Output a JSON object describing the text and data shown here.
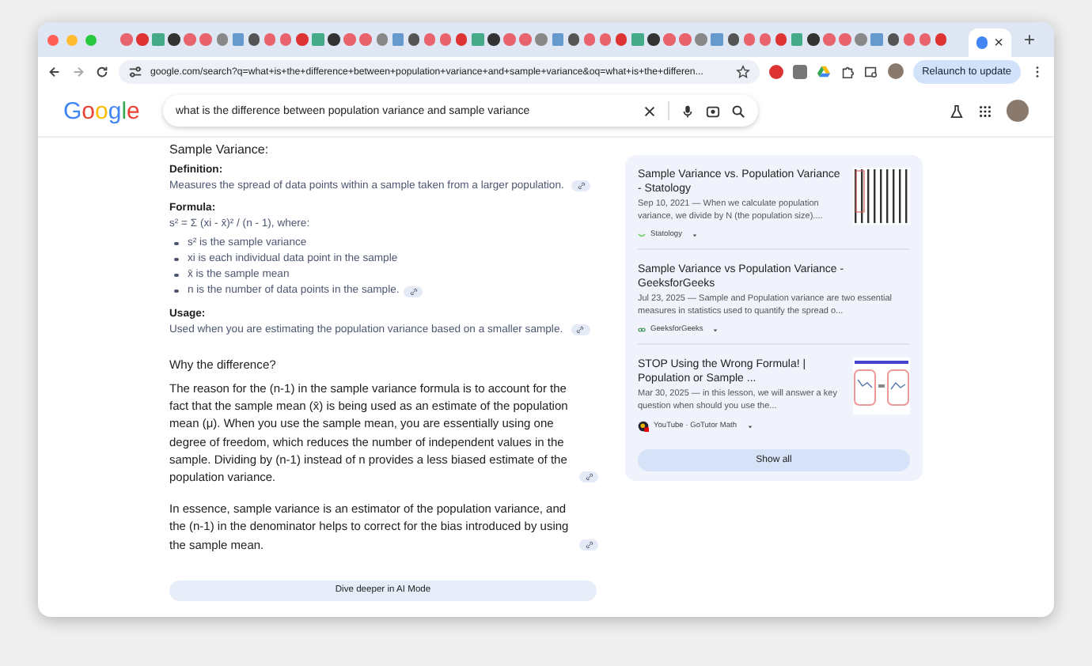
{
  "browser": {
    "new_tab": "+",
    "close_tab": "×",
    "url": "google.com/search?q=what+is+the+difference+between+population+variance+and+sample+variance&oq=what+is+the+differen...",
    "relaunch": "Relaunch to update"
  },
  "search": {
    "logo": "Google",
    "query": "what is the difference between population variance and sample variance"
  },
  "overview": {
    "heading": "Sample Variance:",
    "definition_label": "Definition:",
    "definition": "Measures the spread of data points within a sample taken from a larger population.",
    "formula_label": "Formula:",
    "formula": "s² = Σ (xi - x̄)² / (n - 1), where:",
    "bullets": [
      "s² is the sample variance",
      "xi is each individual data point in the sample",
      "x̄ is the sample mean",
      "n is the number of data points in the sample."
    ],
    "usage_label": "Usage:",
    "usage": "Used when you are estimating the population variance based on a smaller sample.",
    "why_heading": "Why the difference?",
    "paragraphs": [
      "The reason for the (n-1) in the sample variance formula is to account for the fact that the sample mean (x̄) is being used as an estimate of the population mean (μ). When you use the sample mean, you are essentially using one degree of freedom, which reduces the number of independent values in the sample. Dividing by (n-1) instead of n provides a less biased estimate of the population variance.",
      "In essence, sample variance is an estimator of the population variance, and the (n-1) in the denominator helps to correct for the bias introduced by using the sample mean."
    ],
    "dive_button": "Dive deeper in AI Mode"
  },
  "results": [
    {
      "title": "Sample Variance vs. Population Variance - Statology",
      "snippet": "Sep 10, 2021 — When we calculate population variance, we divide by N (the population size)....",
      "source": "Statology",
      "kind": "statology"
    },
    {
      "title": "Sample Variance vs Population Variance - GeeksforGeeks",
      "snippet": "Jul 23, 2025 — Sample and Population variance are two essential measures in statistics used to quantify the spread o...",
      "source": "GeeksforGeeks",
      "kind": "gfg"
    },
    {
      "title": "STOP Using the Wrong Formula! | Population or Sample ...",
      "snippet": "Mar 30, 2025 — in this lesson, we will answer a key question when should you use the...",
      "source": "YouTube · GoTutor Math",
      "kind": "youtube"
    }
  ],
  "show_all": "Show all"
}
